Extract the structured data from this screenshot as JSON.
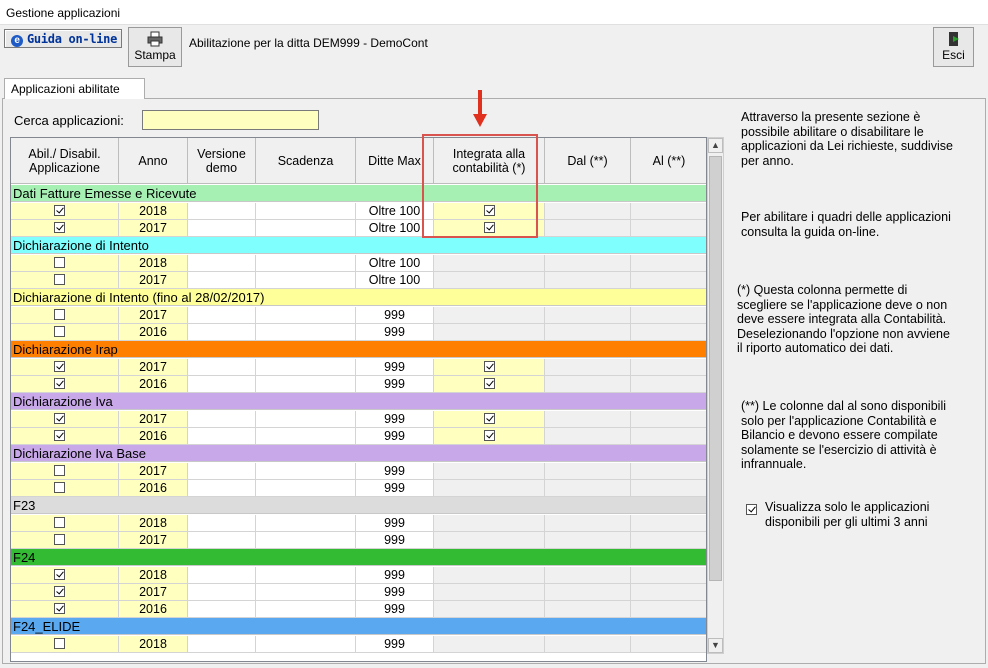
{
  "window": {
    "title": "Gestione applicazioni"
  },
  "toolbar": {
    "guida_label": "Guida on-line",
    "stampa_label": "Stampa",
    "esci_label": "Esci",
    "abilitazione_text": "Abilitazione per la ditta DEM999 -  DemoCont"
  },
  "tab": {
    "label": "Applicazioni abilitate"
  },
  "search": {
    "label": "Cerca applicazioni:",
    "value": ""
  },
  "columns": {
    "abil": "Abil./ Disabil. Applicazione",
    "anno": "Anno",
    "versione": "Versione demo",
    "scadenza": "Scadenza",
    "ditte": "Ditte Max",
    "integrata": "Integrata alla contabilità (*)",
    "dal": "Dal (**)",
    "al": "Al (**)"
  },
  "groups": [
    {
      "name": "Dati Fatture Emesse e Ricevute",
      "color": "#a6f0b4",
      "rows": [
        {
          "checked": true,
          "anno": "2018",
          "ditte": "Oltre 100",
          "integrata": true
        },
        {
          "checked": true,
          "anno": "2017",
          "ditte": "Oltre 100",
          "integrata": true
        }
      ]
    },
    {
      "name": "Dichiarazione di Intento",
      "color": "#80ffff",
      "rows": [
        {
          "checked": false,
          "anno": "2018",
          "ditte": "Oltre 100",
          "integrata": null
        },
        {
          "checked": false,
          "anno": "2017",
          "ditte": "Oltre 100",
          "integrata": null
        }
      ]
    },
    {
      "name": "Dichiarazione di Intento (fino al 28/02/2017)",
      "color": "#ffff99",
      "rows": [
        {
          "checked": false,
          "anno": "2017",
          "ditte": "999",
          "integrata": null
        },
        {
          "checked": false,
          "anno": "2016",
          "ditte": "999",
          "integrata": null
        }
      ]
    },
    {
      "name": "Dichiarazione Irap",
      "color": "#ff8000",
      "rows": [
        {
          "checked": true,
          "anno": "2017",
          "ditte": "999",
          "integrata": true
        },
        {
          "checked": true,
          "anno": "2016",
          "ditte": "999",
          "integrata": true
        }
      ]
    },
    {
      "name": "Dichiarazione Iva",
      "color": "#c8a8e8",
      "rows": [
        {
          "checked": true,
          "anno": "2017",
          "ditte": "999",
          "integrata": true
        },
        {
          "checked": true,
          "anno": "2016",
          "ditte": "999",
          "integrata": true
        }
      ]
    },
    {
      "name": "Dichiarazione Iva Base",
      "color": "#c8a8e8",
      "rows": [
        {
          "checked": false,
          "anno": "2017",
          "ditte": "999",
          "integrata": null
        },
        {
          "checked": false,
          "anno": "2016",
          "ditte": "999",
          "integrata": null
        }
      ]
    },
    {
      "name": "F23",
      "color": "#dcdcdc",
      "rows": [
        {
          "checked": false,
          "anno": "2018",
          "ditte": "999",
          "integrata": null
        },
        {
          "checked": false,
          "anno": "2017",
          "ditte": "999",
          "integrata": null
        }
      ]
    },
    {
      "name": "F24",
      "color": "#33bb33",
      "rows": [
        {
          "checked": true,
          "anno": "2018",
          "ditte": "999",
          "integrata": null
        },
        {
          "checked": true,
          "anno": "2017",
          "ditte": "999",
          "integrata": null
        },
        {
          "checked": true,
          "anno": "2016",
          "ditte": "999",
          "integrata": null
        }
      ]
    },
    {
      "name": "F24_ELIDE",
      "color": "#59a8f0",
      "rows": [
        {
          "checked": false,
          "anno": "2018",
          "ditte": "999",
          "integrata": null
        }
      ]
    }
  ],
  "info": {
    "p1": "Attraverso la presente sezione è possibile abilitare o disabilitare le applicazioni da Lei richieste, suddivise per anno.",
    "p2": "Per abilitare i quadri delle applicazioni consulta la guida on-line.",
    "p3": "(*) Questa colonna permette di scegliere se l'applicazione deve o non deve essere integrata alla Contabilità. Deselezionando l'opzione non avviene il riporto automatico dei dati.",
    "p4": "(**) Le colonne dal al sono disponibili solo per l'applicazione Contabilità e Bilancio e devono essere compilate solamente se l'esercizio di attività è infrannuale."
  },
  "visualizza": {
    "label": "Visualizza solo le applicazioni disponibili per gli ultimi 3 anni",
    "checked": true
  },
  "colors": {
    "yellow_cell": "#ffffc0",
    "gray_cell": "#f0f0f0",
    "highlight": "#d9534f"
  }
}
